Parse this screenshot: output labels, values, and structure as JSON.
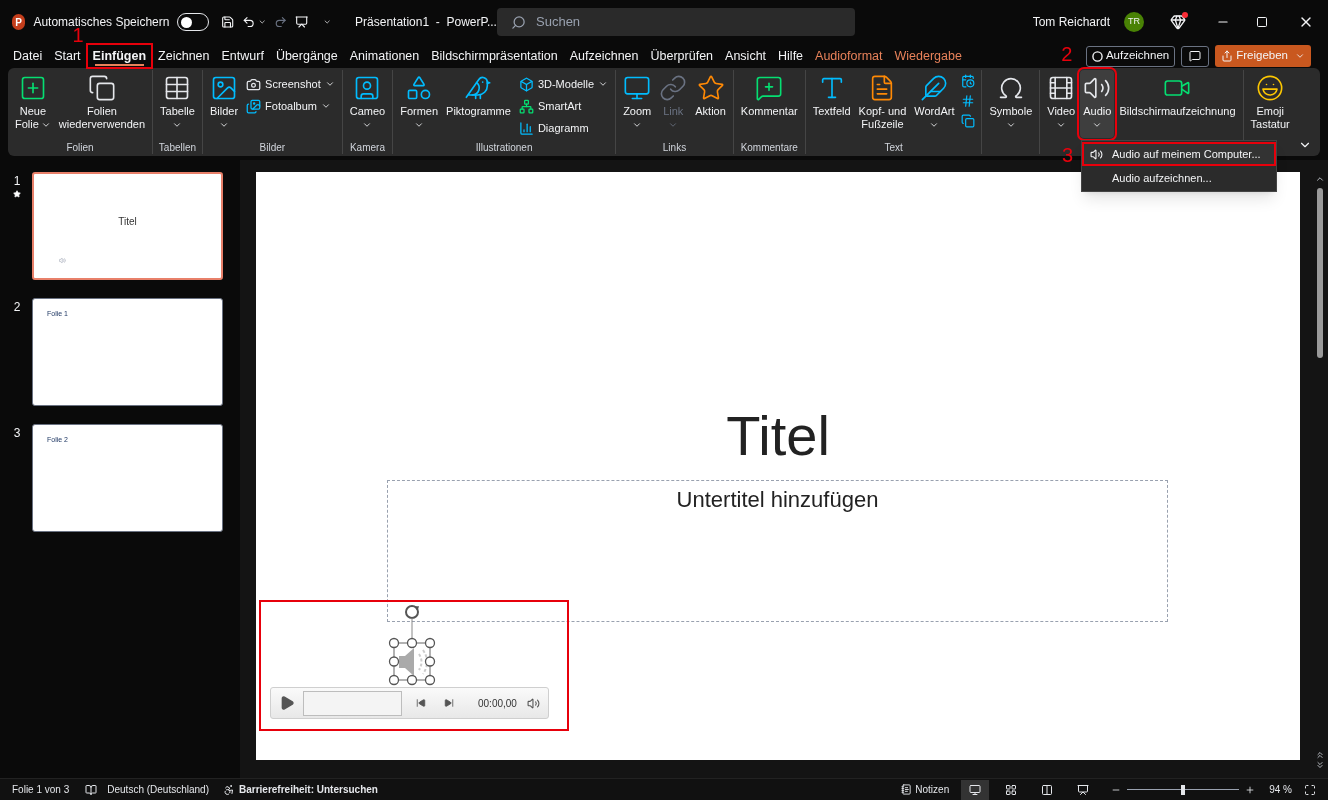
{
  "title_bar": {
    "logo": "P",
    "autosave_label": "Automatisches Speichern",
    "autosave_on": false,
    "document_title": "Präsentation1  -  PowerP...",
    "search_placeholder": "Suchen",
    "user_name": "Tom Reichardt",
    "user_initials": "TR"
  },
  "tabs": [
    {
      "label": "Datei",
      "kind": "standard",
      "selected": false
    },
    {
      "label": "Start",
      "kind": "standard",
      "selected": false
    },
    {
      "label": "Einfügen",
      "kind": "standard",
      "selected": true,
      "highlighted": true,
      "step": "1"
    },
    {
      "label": "Zeichnen",
      "kind": "standard",
      "selected": false
    },
    {
      "label": "Entwurf",
      "kind": "standard",
      "selected": false
    },
    {
      "label": "Übergänge",
      "kind": "standard",
      "selected": false
    },
    {
      "label": "Animationen",
      "kind": "standard",
      "selected": false
    },
    {
      "label": "Bildschirmpräsentation",
      "kind": "standard",
      "selected": false
    },
    {
      "label": "Aufzeichnen",
      "kind": "standard",
      "selected": false
    },
    {
      "label": "Überprüfen",
      "kind": "standard",
      "selected": false
    },
    {
      "label": "Ansicht",
      "kind": "standard",
      "selected": false
    },
    {
      "label": "Hilfe",
      "kind": "standard",
      "selected": false
    },
    {
      "label": "Audioformat",
      "kind": "contextual",
      "selected": false
    },
    {
      "label": "Wiedergabe",
      "kind": "contextual",
      "selected": false
    }
  ],
  "tab_actions": {
    "record_label": "Aufzeichnen",
    "share_label": "Freigeben"
  },
  "ribbon": {
    "groups": [
      {
        "label": "Folien",
        "items": [
          {
            "kind": "large",
            "lines": [
              "Neue",
              "Folie"
            ],
            "caret": true
          },
          {
            "kind": "large",
            "lines": [
              "Folien",
              "wiederverwenden"
            ]
          }
        ]
      },
      {
        "label": "Tabellen",
        "items": [
          {
            "kind": "large",
            "lines": [
              "Tabelle"
            ],
            "caret": true
          }
        ]
      },
      {
        "label": "Bilder",
        "items": [
          {
            "kind": "large",
            "lines": [
              "Bilder"
            ],
            "caret": true
          },
          {
            "kind": "stack",
            "items": [
              {
                "kind": "small",
                "label": "Screenshot",
                "caret": true
              },
              {
                "kind": "small",
                "label": "Fotoalbum",
                "caret": true
              }
            ]
          }
        ]
      },
      {
        "label": "Kamera",
        "items": [
          {
            "kind": "large",
            "lines": [
              "Cameo"
            ],
            "caret": true
          }
        ]
      },
      {
        "label": "Illustrationen",
        "items": [
          {
            "kind": "large",
            "lines": [
              "Formen"
            ],
            "caret": true
          },
          {
            "kind": "large",
            "lines": [
              "Piktogramme"
            ]
          },
          {
            "kind": "stack",
            "items": [
              {
                "kind": "small",
                "label": "3D-Modelle",
                "caret": true
              },
              {
                "kind": "small",
                "label": "SmartArt",
                "caret": false
              },
              {
                "kind": "small",
                "label": "Diagramm",
                "caret": false
              }
            ]
          }
        ]
      },
      {
        "label": "Links",
        "items": [
          {
            "kind": "large",
            "lines": [
              "Zoom"
            ],
            "caret": true
          },
          {
            "kind": "large",
            "lines": [
              "Link"
            ],
            "caret": true,
            "disabled": true
          },
          {
            "kind": "large",
            "lines": [
              "Aktion"
            ]
          }
        ]
      },
      {
        "label": "Kommentare",
        "items": [
          {
            "kind": "large",
            "lines": [
              "Kommentar"
            ]
          }
        ]
      },
      {
        "label": "Text",
        "items": [
          {
            "kind": "large",
            "lines": [
              "Textfeld"
            ]
          },
          {
            "kind": "large",
            "lines": [
              "Kopf- und",
              "Fußzeile"
            ]
          },
          {
            "kind": "large",
            "lines": [
              "WordArt"
            ],
            "caret": true
          },
          {
            "kind": "stack",
            "items": [
              {
                "kind": "icon"
              },
              {
                "kind": "icon"
              },
              {
                "kind": "icon"
              }
            ]
          }
        ]
      },
      {
        "items": [
          {
            "kind": "large",
            "lines": [
              "Symbole"
            ],
            "caret": true
          }
        ]
      },
      {
        "items": [
          {
            "kind": "large",
            "lines": [
              "Video"
            ],
            "caret": true
          },
          {
            "kind": "large",
            "lines": [
              "Audio"
            ],
            "caret": true,
            "expanded": true,
            "highlighted": true,
            "step": "2"
          },
          {
            "kind": "large",
            "lines": [
              "Bildschirmaufzeichnung"
            ]
          }
        ]
      },
      {
        "items": [
          {
            "kind": "large",
            "lines": [
              "Emoji",
              "Tastatur"
            ]
          }
        ]
      }
    ]
  },
  "audio_menu": {
    "items": [
      {
        "label": "Audio auf meinem Computer...",
        "highlighted": true,
        "step": "3",
        "icon": true
      },
      {
        "label": "Audio aufzeichnen...",
        "highlighted": false,
        "icon": false
      }
    ]
  },
  "thumbnails": [
    {
      "number": "1",
      "selected": true,
      "transition": true,
      "kind": "title",
      "text": "Titel",
      "audio": true
    },
    {
      "number": "2",
      "selected": false,
      "transition": false,
      "kind": "content",
      "text": "Folie 1",
      "audio": false
    },
    {
      "number": "3",
      "selected": false,
      "transition": false,
      "kind": "content",
      "text": "Folie 2",
      "audio": false
    }
  ],
  "slide": {
    "title": "Titel",
    "subtitle_placeholder": "Untertitel hinzufügen",
    "audio_player": {
      "time": "00:00,00",
      "highlighted": true
    }
  },
  "status_bar": {
    "slide_info": "Folie 1 von 3",
    "language": "Deutsch (Deutschland)",
    "accessibility": "Barrierefreiheit: Untersuchen",
    "notes": "Notizen",
    "views": [
      {
        "selected": true
      },
      {
        "selected": false
      },
      {
        "selected": false
      },
      {
        "selected": false
      }
    ],
    "zoom": {
      "level": 0.5
    },
    "zoom_label": "94 %"
  }
}
